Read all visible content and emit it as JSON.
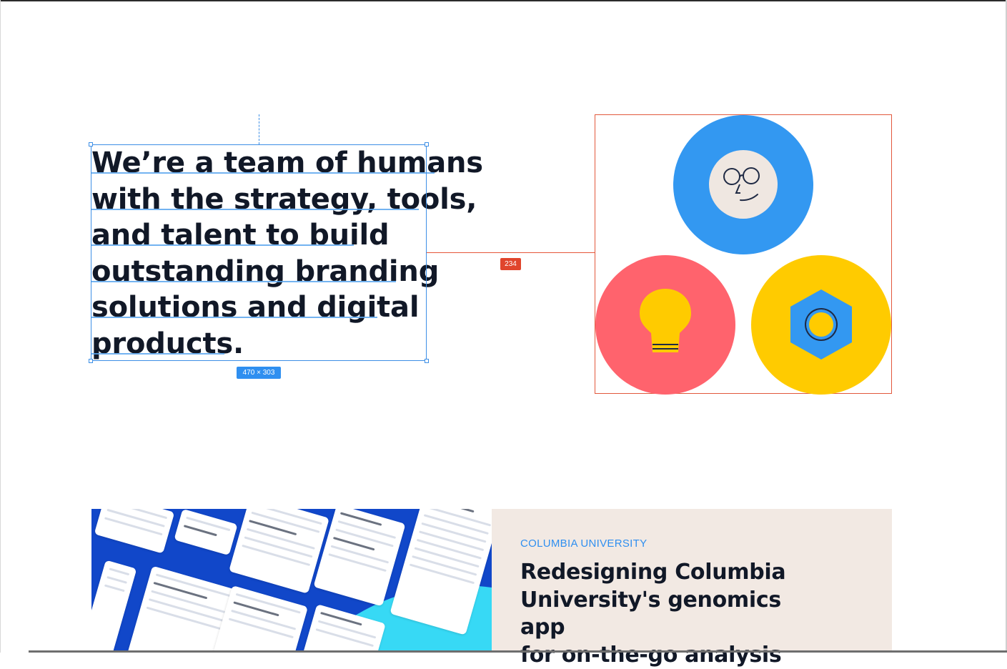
{
  "hero": {
    "headline_lines": [
      "We’re a team of humans",
      "with the strategy, tools,",
      "and talent to build",
      "outstanding branding",
      "solutions and digital",
      "products."
    ]
  },
  "inspector": {
    "selection_size": "470 × 303",
    "spacing_value": "234",
    "selection_color": "#3d8fe6",
    "measure_color": "#e0452c"
  },
  "illustration": {
    "icons": [
      "face-icon",
      "lightbulb-icon",
      "hex-nut-icon"
    ],
    "colors": {
      "blue": "#3398f1",
      "red": "#ff636d",
      "yellow": "#ffcb00"
    }
  },
  "case_study": {
    "kicker": "COLUMBIA UNIVERSITY",
    "title_lines": [
      "Redesigning Columbia",
      "University's genomics app",
      "for on-the-go analysis"
    ],
    "background": "#f2e9e3",
    "accent": "#2f8ff0"
  }
}
